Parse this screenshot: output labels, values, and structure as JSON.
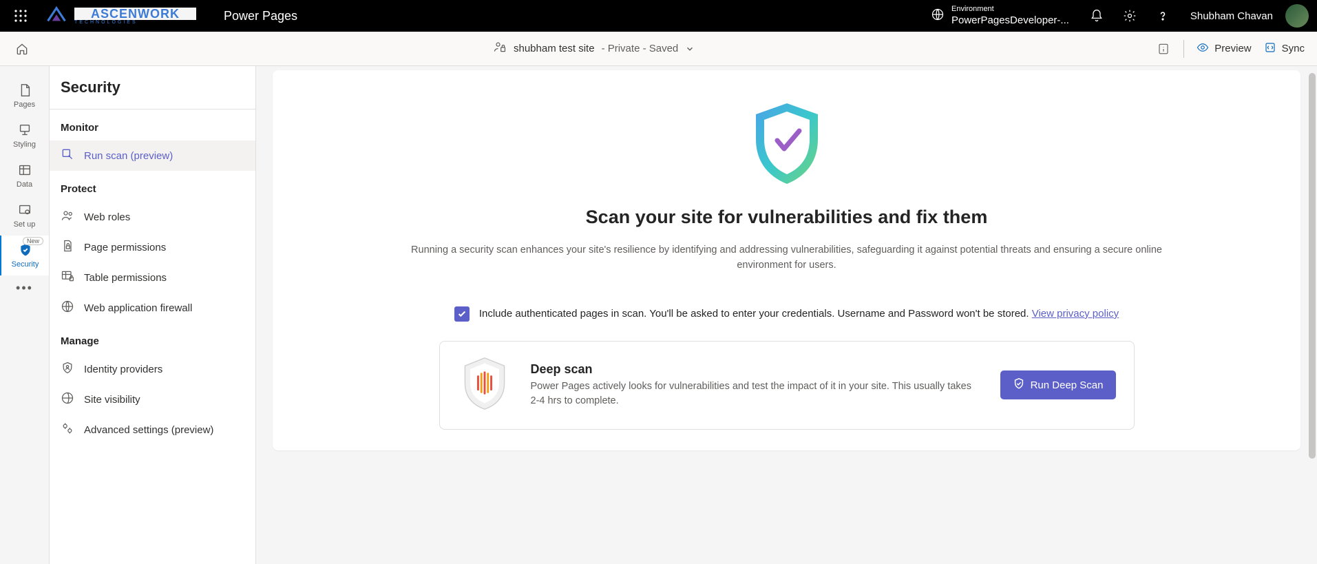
{
  "header": {
    "app_name": "Power Pages",
    "logo_main": "ASCENWORK",
    "logo_sub": "TECHNOLOGIES",
    "env_label": "Environment",
    "env_value": "PowerPagesDeveloper-...",
    "user_name": "Shubham Chavan"
  },
  "command_bar": {
    "site_name": "shubham test site",
    "site_status": " - Private - Saved",
    "preview": "Preview",
    "sync": "Sync"
  },
  "rail": {
    "pages": "Pages",
    "styling": "Styling",
    "data": "Data",
    "setup": "Set up",
    "security": "Security",
    "new_badge": "New"
  },
  "sidebar": {
    "title": "Security",
    "sections": {
      "monitor": "Monitor",
      "protect": "Protect",
      "manage": "Manage"
    },
    "items": {
      "run_scan": "Run scan (preview)",
      "web_roles": "Web roles",
      "page_permissions": "Page permissions",
      "table_permissions": "Table permissions",
      "waf": "Web application firewall",
      "identity_providers": "Identity providers",
      "site_visibility": "Site visibility",
      "advanced_settings": "Advanced settings (preview)"
    }
  },
  "main": {
    "hero_title": "Scan your site for vulnerabilities and fix them",
    "hero_desc": "Running a security scan enhances your site's resilience by identifying and addressing vulnerabilities, safeguarding it against potential threats and ensuring a secure online environment for users.",
    "consent_text": "Include authenticated pages in scan. You'll be asked to enter your credentials. Username and Password won't be stored. ",
    "privacy_link": "View privacy policy",
    "deep_scan": {
      "title": "Deep scan",
      "desc": "Power Pages actively looks for vulnerabilities and test the impact of it in your site. This usually takes 2-4 hrs to complete.",
      "button": "Run Deep Scan"
    }
  }
}
